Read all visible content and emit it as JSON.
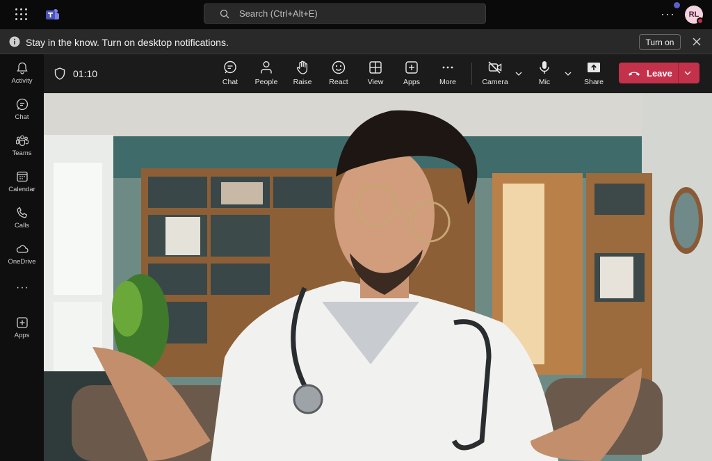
{
  "titlebar": {
    "search_placeholder": "Search (Ctrl+Alt+E)",
    "avatar_initials": "RL",
    "more_label": "···"
  },
  "notification": {
    "message": "Stay in the know. Turn on desktop notifications.",
    "button_label": "Turn on"
  },
  "rail": {
    "items": [
      {
        "label": "Activity",
        "icon": "bell-icon"
      },
      {
        "label": "Chat",
        "icon": "chat-icon"
      },
      {
        "label": "Teams",
        "icon": "teams-icon"
      },
      {
        "label": "Calendar",
        "icon": "calendar-icon"
      },
      {
        "label": "Calls",
        "icon": "phone-icon"
      },
      {
        "label": "OneDrive",
        "icon": "cloud-icon"
      },
      {
        "label": "Apps",
        "icon": "plus-square-icon"
      }
    ],
    "more_label": "···"
  },
  "meeting": {
    "timer": "01:10",
    "buttons": {
      "chat": "Chat",
      "people": "People",
      "raise": "Raise",
      "react": "React",
      "view": "View",
      "apps": "Apps",
      "more": "More",
      "camera": "Camera",
      "mic": "Mic",
      "share": "Share"
    },
    "leave_label": "Leave"
  },
  "colors": {
    "leave": "#c4314b",
    "accent": "#5b5fc7"
  }
}
